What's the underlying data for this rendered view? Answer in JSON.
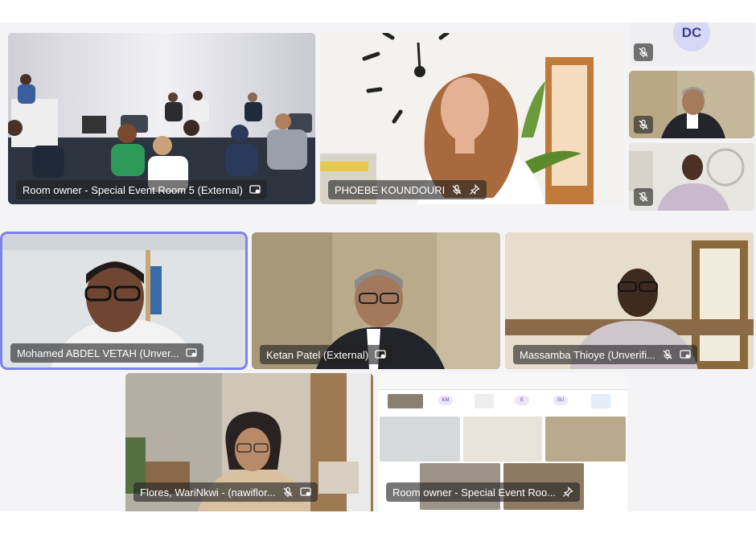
{
  "participants": {
    "room5": {
      "name": "Room owner - Special Event Room 5 (External)"
    },
    "phoebe": {
      "name": "PHOEBE KOUNDOURI"
    },
    "dc": {
      "initials": "DC"
    },
    "mohamed": {
      "name": "Mohamed ABDEL VETAH (Unver..."
    },
    "ketan": {
      "name": "Ketan Patel (External)"
    },
    "massamba": {
      "name": "Massamba Thioye (Unverifi..."
    },
    "flores": {
      "name": "Flores, WariNkwi - (nawiflor..."
    },
    "room_share": {
      "name": "Room owner - Special Event Roo..."
    }
  },
  "share_preview": {
    "chips": [
      "KM",
      "E",
      "SU"
    ]
  },
  "icons": {
    "mic_off": "mic-off-icon",
    "screen_share": "screen-share-icon",
    "pin": "pin-icon"
  },
  "colors": {
    "stage_bg": "#f4f4f6",
    "label_bg": "#222222",
    "active_outline": "#7b83eb",
    "avatar_bg": "#d6d8f5"
  }
}
